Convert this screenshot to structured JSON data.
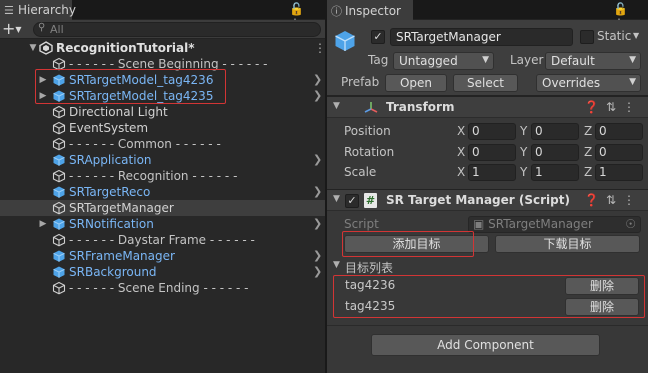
{
  "hierarchy": {
    "tab_label": "Hierarchy",
    "add_label": "+",
    "search_placeholder": "All",
    "scene_name": "RecognitionTutorial*",
    "items": [
      {
        "label": "- - - - - - Scene Beginning - - - - - -",
        "style": "gray",
        "icon": "gameobject-icon"
      },
      {
        "label": "SRTargetModel_tag4236",
        "style": "blue",
        "icon": "prefab-icon"
      },
      {
        "label": "SRTargetModel_tag4235",
        "style": "blue",
        "icon": "prefab-icon"
      },
      {
        "label": "Directional Light",
        "style": "white",
        "icon": "gameobject-icon"
      },
      {
        "label": "EventSystem",
        "style": "white",
        "icon": "gameobject-icon"
      },
      {
        "label": "- - - - - - Common - - - - - -",
        "style": "gray",
        "icon": "gameobject-icon"
      },
      {
        "label": "SRApplication",
        "style": "blue",
        "icon": "prefab-icon"
      },
      {
        "label": "- - - - - - Recognition - - - - - -",
        "style": "gray",
        "icon": "gameobject-icon"
      },
      {
        "label": "SRTargetReco",
        "style": "blue",
        "icon": "prefab-icon"
      },
      {
        "label": "SRTargetManager",
        "style": "white",
        "icon": "gameobject-icon"
      },
      {
        "label": "SRNotification",
        "style": "blue",
        "icon": "prefab-icon"
      },
      {
        "label": "- - - - - - Daystar Frame - - - - - -",
        "style": "gray",
        "icon": "gameobject-icon"
      },
      {
        "label": "SRFrameManager",
        "style": "blue",
        "icon": "prefab-icon"
      },
      {
        "label": "SRBackground",
        "style": "blue",
        "icon": "prefab-icon"
      },
      {
        "label": "- - - - - - Scene Ending - - - - - -",
        "style": "gray",
        "icon": "gameobject-icon"
      }
    ]
  },
  "inspector": {
    "tab_label": "Inspector",
    "object_name": "SRTargetManager",
    "static_label": "Static",
    "tag_label": "Tag",
    "tag_value": "Untagged",
    "layer_label": "Layer",
    "layer_value": "Default",
    "prefab_label": "Prefab",
    "open_label": "Open",
    "select_label": "Select",
    "overrides_label": "Overrides",
    "transform": {
      "title": "Transform",
      "position_label": "Position",
      "rotation_label": "Rotation",
      "scale_label": "Scale",
      "axis_x": "X",
      "axis_y": "Y",
      "axis_z": "Z",
      "position": [
        "0",
        "0",
        "0"
      ],
      "rotation": [
        "0",
        "0",
        "0"
      ],
      "scale": [
        "1",
        "1",
        "1"
      ]
    },
    "script_component": {
      "title": "SR Target Manager (Script)",
      "script_label": "Script",
      "script_value": "SRTargetManager",
      "add_target_label": "添加目标",
      "download_target_label": "下载目标",
      "list_label": "目标列表",
      "targets": [
        {
          "name": "tag4236",
          "delete_label": "删除"
        },
        {
          "name": "tag4235",
          "delete_label": "删除"
        }
      ]
    },
    "add_component_label": "Add Component"
  },
  "colors": {
    "highlight_box": "#d23535",
    "prefab_blue": "#7ab6f5",
    "panel_bg": "#282828",
    "inspector_bg": "#383838"
  }
}
